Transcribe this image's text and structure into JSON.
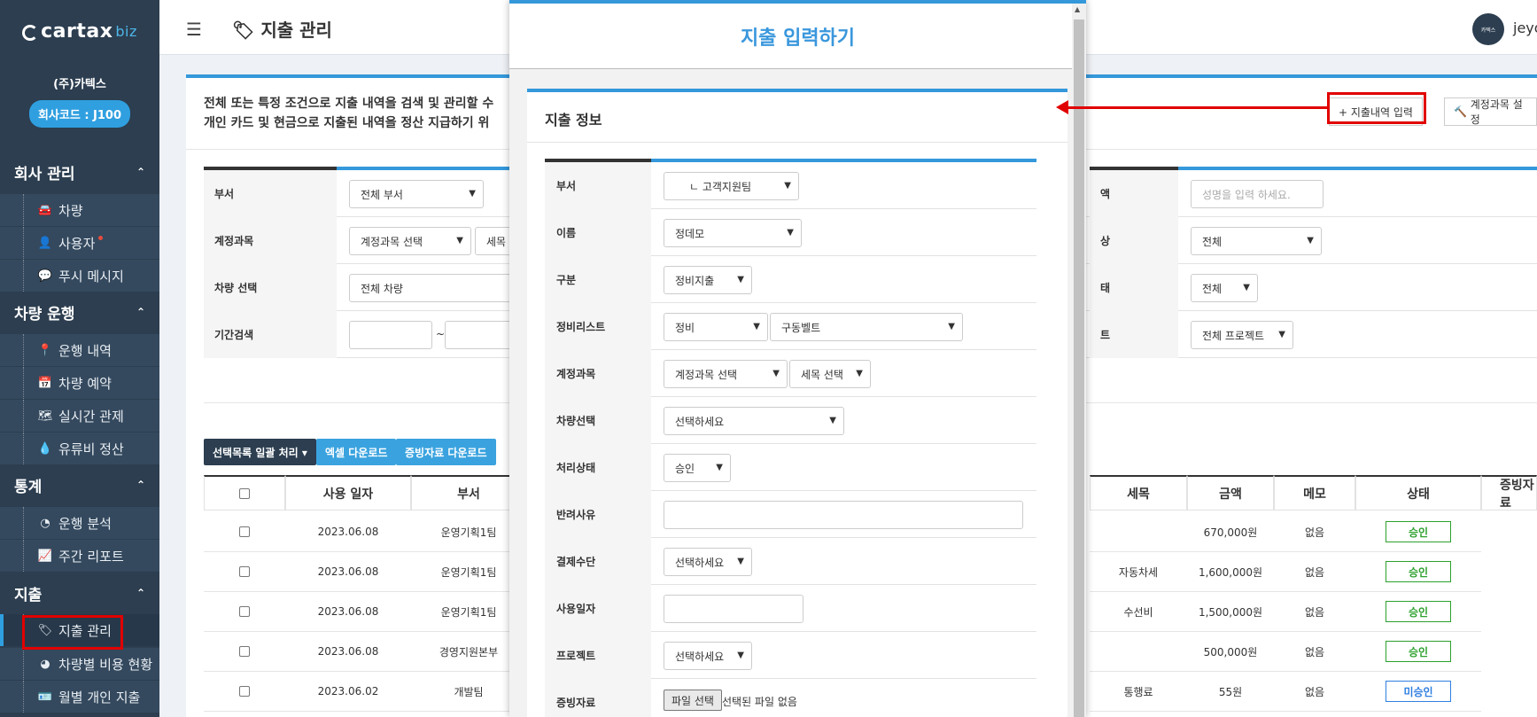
{
  "sidebar": {
    "logo_main": "cartax",
    "logo_sub": "biz",
    "company": "(주)카텍스",
    "company_code": "회사코드 : J100",
    "sections": [
      {
        "label": "회사 관리",
        "items": [
          "차량",
          "사용자",
          "푸시 메시지"
        ]
      },
      {
        "label": "차량 운행",
        "items": [
          "운행 내역",
          "차량 예약",
          "실시간 관제",
          "유류비 정산"
        ]
      },
      {
        "label": "통계",
        "items": [
          "운행 분석",
          "주간 리포트"
        ]
      },
      {
        "label": "지출",
        "items": [
          "지출 관리",
          "차량별 비용 현황",
          "월별 개인 지출"
        ]
      }
    ],
    "active_item": "지출 관리"
  },
  "topbar": {
    "title": "지출 관리",
    "avatar_text": "카텍스",
    "user": "jeyo"
  },
  "main": {
    "desc_line1": "전체 또는 특정 조건으로 지출 내역을 검색 및 관리할 수",
    "desc_line2": "개인 카드 및 현금으로 지출된 내역을 정산 지급하기 위",
    "add_button": "+ 지출내역 입력",
    "account_button": "계정과목 설정",
    "filters": {
      "dept_label": "부서",
      "dept_value": "전체 부서",
      "account_label": "계정과목",
      "account_value": "계정과목 선택",
      "sub_value": "세목",
      "vehicle_label": "차량 선택",
      "vehicle_value": "전체 차량",
      "period_label": "기간검색",
      "period_sep": "~",
      "name_label": "액",
      "name_placeholder": "성명을 입력 하세요.",
      "right2_label": "상",
      "right2_value": "전체",
      "right3_label": "태",
      "right3_value": "전체",
      "right4_label": "트",
      "right4_value": "전체 프로젝트"
    },
    "actions": {
      "bulk": "선택목록 일괄 처리 ▾",
      "excel": "엑셀 다운로드",
      "evidence": "증빙자료 다운로드"
    },
    "table": {
      "headers": [
        "사용 일자",
        "부서",
        "세목",
        "금액",
        "메모",
        "상태",
        "증빙자료"
      ],
      "rows": [
        {
          "date": "2023.06.08",
          "dept": "운영기획1팀",
          "sub": "",
          "amount": "670,000원",
          "memo": "없음",
          "status": "승인"
        },
        {
          "date": "2023.06.08",
          "dept": "운영기획1팀",
          "sub": "자동차세",
          "amount": "1,600,000원",
          "memo": "없음",
          "status": "승인"
        },
        {
          "date": "2023.06.08",
          "dept": "운영기획1팀",
          "sub": "수선비",
          "amount": "1,500,000원",
          "memo": "없음",
          "status": "승인"
        },
        {
          "date": "2023.06.08",
          "dept": "경영지원본부",
          "sub": "",
          "amount": "500,000원",
          "memo": "없음",
          "status": "승인"
        },
        {
          "date": "2023.06.02",
          "dept": "개발팀",
          "sub": "통행료",
          "amount": "55원",
          "memo": "없음",
          "status": "미승인"
        }
      ]
    }
  },
  "modal": {
    "title": "지출 입력하기",
    "section_title": "지출 정보",
    "fields": {
      "dept_label": "부서",
      "dept_value": "ㄴ 고객지원팀",
      "name_label": "이름",
      "name_value": "정데모",
      "type_label": "구분",
      "type_value": "정비지출",
      "maint_label": "정비리스트",
      "maint_value1": "정비",
      "maint_value2": "구동벨트",
      "account_label": "계정과목",
      "account_value": "계정과목 선택",
      "sub_value": "세목 선택",
      "vehicle_label": "차량선택",
      "vehicle_value": "선택하세요",
      "state_label": "처리상태",
      "state_value": "승인",
      "reject_label": "반려사유",
      "pay_label": "결제수단",
      "pay_value": "선택하세요",
      "date_label": "사용일자",
      "project_label": "프로젝트",
      "project_value": "선택하세요",
      "file_label": "증빙자료",
      "file_button": "파일 선택",
      "file_none": "선택된 파일 없음"
    }
  },
  "colors": {
    "sidebar_bg": "#2c3e50",
    "accent": "#3498db",
    "highlight": "#e10000",
    "approved": "#2ca02c",
    "pending": "#2f7fe0"
  }
}
